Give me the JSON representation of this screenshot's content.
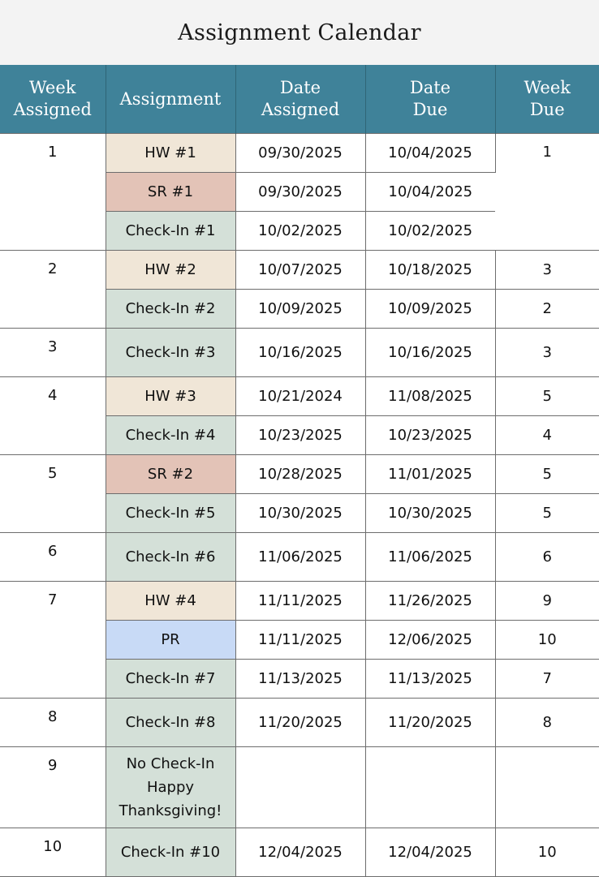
{
  "title": "Assignment Calendar",
  "headers": {
    "week_assigned": [
      "Week",
      "Assigned"
    ],
    "assignment": [
      "Assignment"
    ],
    "date_assigned": [
      "Date",
      "Assigned"
    ],
    "date_due": [
      "Date",
      "Due"
    ],
    "week_due": [
      "Week",
      "Due"
    ]
  },
  "rows": [
    {
      "week": "1",
      "assignment": "HW #1",
      "type": "hw",
      "assigned": "09/30/2025",
      "due": "10/04/2025",
      "week_due": "1"
    },
    {
      "week": "",
      "assignment": "SR #1",
      "type": "sr",
      "assigned": "09/30/2025",
      "due": "10/04/2025",
      "week_due": ""
    },
    {
      "week": "",
      "assignment": "Check-In #1",
      "type": "ci",
      "assigned": "10/02/2025",
      "due": "10/02/2025",
      "week_due": ""
    },
    {
      "week": "2",
      "assignment": "HW #2",
      "type": "hw",
      "assigned": "10/07/2025",
      "due": "10/18/2025",
      "week_due": "3"
    },
    {
      "week": "",
      "assignment": "Check-In  #2",
      "type": "ci",
      "assigned": "10/09/2025",
      "due": "10/09/2025",
      "week_due": "2"
    },
    {
      "week": "3",
      "assignment": "Check-In  #3",
      "type": "ci",
      "assigned": "10/16/2025",
      "due": "10/16/2025",
      "week_due": "3"
    },
    {
      "week": "4",
      "assignment": "HW #3",
      "type": "hw",
      "assigned": "10/21/2024",
      "due": "11/08/2025",
      "week_due": "5"
    },
    {
      "week": "",
      "assignment": "Check-In  #4",
      "type": "ci",
      "assigned": "10/23/2025",
      "due": "10/23/2025",
      "week_due": "4"
    },
    {
      "week": "5",
      "assignment": "SR #2",
      "type": "sr",
      "assigned": "10/28/2025",
      "due": "11/01/2025",
      "week_due": "5"
    },
    {
      "week": "",
      "assignment": "Check-In  #5",
      "type": "ci",
      "assigned": "10/30/2025",
      "due": "10/30/2025",
      "week_due": "5"
    },
    {
      "week": "6",
      "assignment": "Check-In  #6",
      "type": "ci",
      "assigned": "11/06/2025",
      "due": "11/06/2025",
      "week_due": "6"
    },
    {
      "week": "7",
      "assignment": "HW #4",
      "type": "hw",
      "assigned": "11/11/2025",
      "due": "11/26/2025",
      "week_due": "9"
    },
    {
      "week": "",
      "assignment": "PR",
      "type": "pr",
      "assigned": "11/11/2025",
      "due": "12/06/2025",
      "week_due": "10"
    },
    {
      "week": "",
      "assignment": "Check-In  #7",
      "type": "ci",
      "assigned": "11/13/2025",
      "due": "11/13/2025",
      "week_due": "7"
    },
    {
      "week": "8",
      "assignment": "Check-In #8",
      "type": "ci",
      "assigned": "11/20/2025",
      "due": "11/20/2025",
      "week_due": "8"
    },
    {
      "week": "9",
      "assignment_lines": [
        "No Check-In",
        "Happy",
        "Thanksgiving!"
      ],
      "type": "ci",
      "assigned": "",
      "due": "",
      "week_due": ""
    },
    {
      "week": "10",
      "assignment": "Check-In #10",
      "type": "ci",
      "assigned": "12/04/2025",
      "due": "12/04/2025",
      "week_due": "10"
    }
  ]
}
